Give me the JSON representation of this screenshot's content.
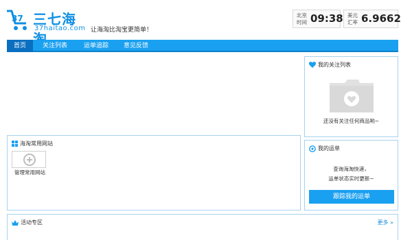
{
  "header": {
    "logo_title": "三七海淘",
    "logo_domain": "37haitao.com",
    "slogan": "让海淘比淘宝更简单！",
    "time_label": "北京时间",
    "time_value": "09:38",
    "rate_label": "美元汇率",
    "rate_value": "6.9662"
  },
  "nav": {
    "items": [
      {
        "label": "首页"
      },
      {
        "label": "关注列表"
      },
      {
        "label": "运单追踪"
      },
      {
        "label": "意见反馈"
      }
    ]
  },
  "sites": {
    "title": "海淘常用网站",
    "manage_label": "管理常用网站"
  },
  "watchlist": {
    "title": "我的关注列表",
    "empty_text": "还没有关注任何商品哟~"
  },
  "tracking": {
    "title": "我的运单",
    "line1": "查询海淘快递，",
    "line2": "运单状态实时更新~",
    "button": "跟踪我的运单"
  },
  "activity": {
    "title": "活动专区",
    "more": "更多 »"
  },
  "colors": {
    "accent": "#1aa0f0",
    "nav_active": "#0a6fc0",
    "panel_border": "#a7d2ee"
  }
}
